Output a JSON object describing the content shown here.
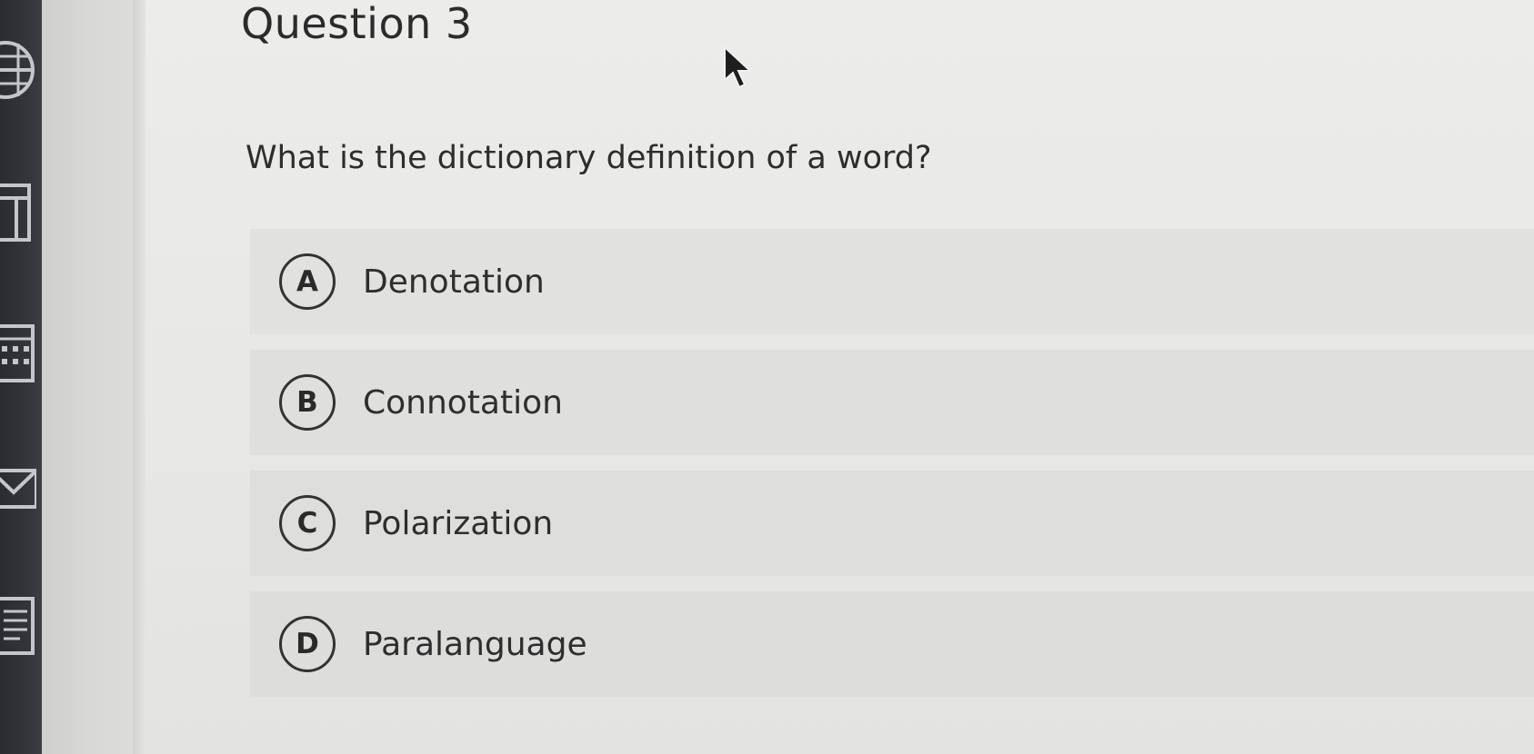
{
  "question": {
    "title": "Question 3",
    "text": "What is the dictionary definition of a word?"
  },
  "options": [
    {
      "letter": "A",
      "label": "Denotation"
    },
    {
      "letter": "B",
      "label": "Connotation"
    },
    {
      "letter": "C",
      "label": "Polarization"
    },
    {
      "letter": "D",
      "label": "Paralanguage"
    }
  ],
  "rail": {
    "icons": [
      "globe-icon",
      "book-icon",
      "calendar-icon",
      "inbox-icon",
      "document-icon"
    ]
  }
}
